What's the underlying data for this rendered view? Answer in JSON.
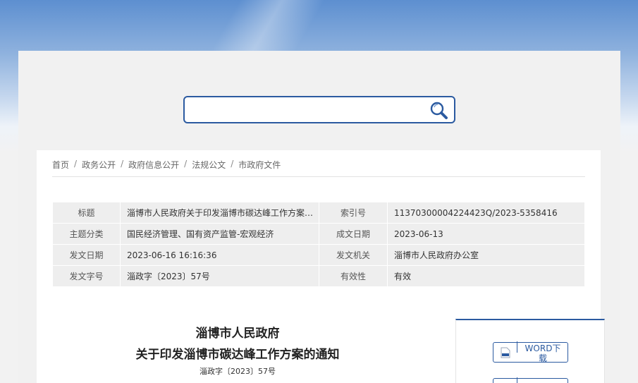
{
  "search": {
    "value": "",
    "placeholder": ""
  },
  "breadcrumb": [
    "首页",
    "政务公开",
    "政府信息公开",
    "法规公文",
    "市政府文件"
  ],
  "breadcrumb_separator": "/",
  "meta": {
    "title_label": "标题",
    "title_value": "淄博市人民政府关于印发淄博市碳达峰工作方案的通知",
    "index_label": "索引号",
    "index_value": "11370300004224423Q/2023-5358416",
    "topic_label": "主题分类",
    "topic_value": "国民经济管理、国有资产监管-宏观经济",
    "created_label": "成文日期",
    "created_value": "2023-06-13",
    "issued_label": "发文日期",
    "issued_value": "2023-06-16 16:16:36",
    "agency_label": "发文机关",
    "agency_value": "淄博市人民政府办公室",
    "docno_label": "发文字号",
    "docno_value": "淄政字〔2023〕57号",
    "validity_label": "有效性",
    "validity_value": "有效"
  },
  "document": {
    "title_line1": "淄博市人民政府",
    "title_line2": "关于印发淄博市碳达峰工作方案的通知",
    "number": "淄政字〔2023〕57号"
  },
  "downloads": {
    "word_label": "WORD下载"
  },
  "colors": {
    "accent": "#2b5aa0",
    "table_bg": "#eeeeee",
    "page_bg": "#f1f1f1"
  },
  "icons": {
    "search": "magnifier-icon",
    "word": "document-icon"
  }
}
